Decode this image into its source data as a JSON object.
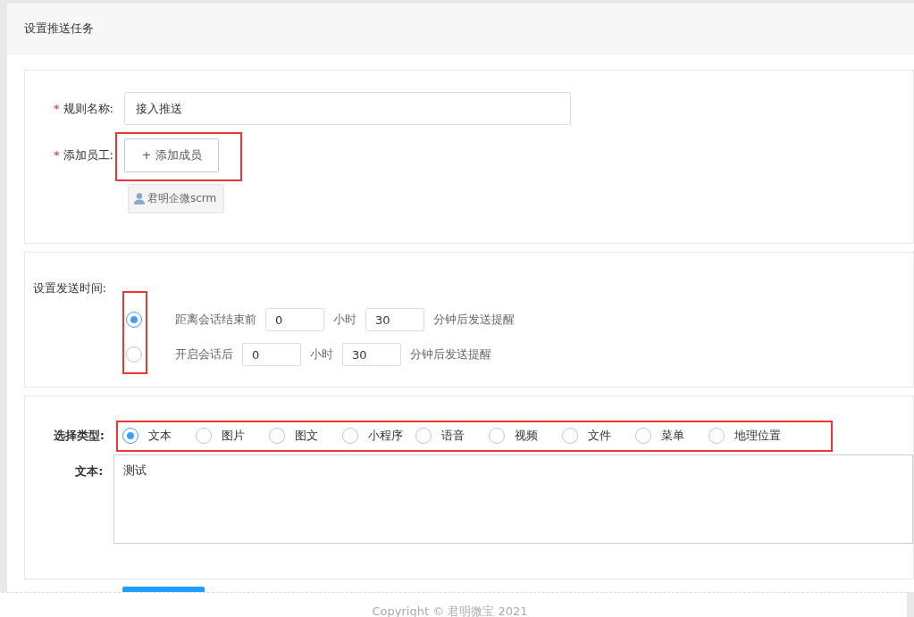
{
  "page_title": "设置推送任务",
  "rule": {
    "mark": "*",
    "label": "规则名称:",
    "value": "接入推送"
  },
  "staff": {
    "mark": "*",
    "label": "添加员工:",
    "button": "+ 添加成员",
    "members": [
      "君明企微scrm"
    ]
  },
  "send_time": {
    "label": "设置发送时间:",
    "options": [
      {
        "prefix": "距离会话结束前",
        "hours": "0",
        "hours_unit": "小时",
        "minutes": "30",
        "suffix": "分钟后发送提醒",
        "selected": true
      },
      {
        "prefix": "开启会话后",
        "hours": "0",
        "hours_unit": "小时",
        "minutes": "30",
        "suffix": "分钟后发送提醒",
        "selected": false
      }
    ]
  },
  "message": {
    "type_label": "选择类型:",
    "types": [
      {
        "label": "文本",
        "selected": true
      },
      {
        "label": "图片",
        "selected": false
      },
      {
        "label": "图文",
        "selected": false
      },
      {
        "label": "小程序",
        "selected": false
      },
      {
        "label": "语音",
        "selected": false
      },
      {
        "label": "视频",
        "selected": false
      },
      {
        "label": "文件",
        "selected": false
      },
      {
        "label": "菜单",
        "selected": false
      },
      {
        "label": "地理位置",
        "selected": false
      }
    ],
    "text_label": "文本:",
    "text": "测试"
  },
  "footer": "Copyright © 君明微宝 2021"
}
